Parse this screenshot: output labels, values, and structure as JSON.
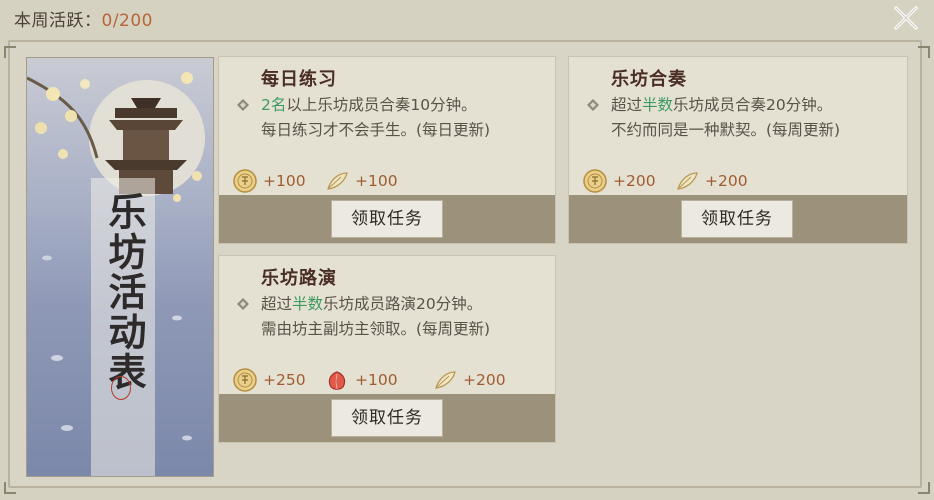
{
  "header": {
    "activity_label": "本周活跃：",
    "activity_value": "0/200"
  },
  "banner": {
    "title": "乐坊活动表",
    "seal_text": "印"
  },
  "tasks": [
    {
      "title": "每日练习",
      "desc_line1_hl": "2名",
      "desc_line1_rest": "以上乐坊成员合奏10分钟。",
      "desc_line2": "每日练习才不会手生。(每日更新)",
      "rewards": [
        {
          "icon": "coin-icon",
          "value": "+100"
        },
        {
          "icon": "feather-icon",
          "value": "+100"
        }
      ],
      "button": "领取任务"
    },
    {
      "title": "乐坊合奏",
      "desc_line1_pre": "超过",
      "desc_line1_hl": "半数",
      "desc_line1_rest": "乐坊成员合奏20分钟。",
      "desc_line2": "不约而同是一种默契。(每周更新)",
      "rewards": [
        {
          "icon": "coin-icon",
          "value": "+200"
        },
        {
          "icon": "feather-icon",
          "value": "+200"
        }
      ],
      "button": "领取任务"
    },
    {
      "title": "乐坊路演",
      "desc_line1_pre": "超过",
      "desc_line1_hl": "半数",
      "desc_line1_rest": "乐坊成员路演20分钟。",
      "desc_line2": "需由坊主副坊主领取。(每周更新)",
      "rewards": [
        {
          "icon": "coin-icon",
          "value": "+250"
        },
        {
          "icon": "peach-icon",
          "value": "+100"
        },
        {
          "icon": "feather-icon",
          "value": "+200"
        }
      ],
      "button": "领取任务"
    }
  ],
  "colors": {
    "accent_value": "#b8653a",
    "highlight": "#3f9a62",
    "title": "#4a2d24"
  }
}
